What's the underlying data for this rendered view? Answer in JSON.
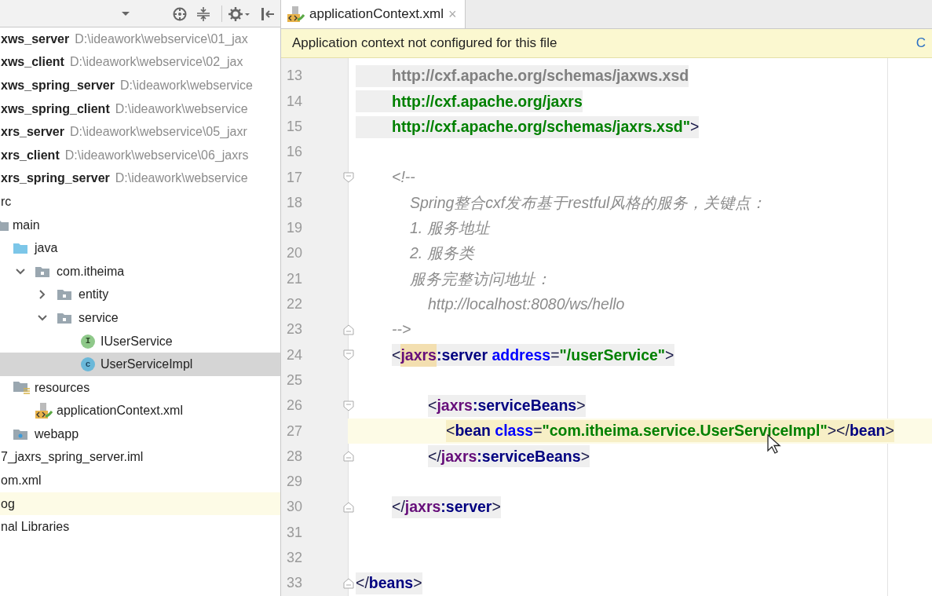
{
  "project_panel": {
    "tree": [
      {
        "name": "xws_server",
        "path": "D:\\ideawork\\webservice\\01_jax"
      },
      {
        "name": "xws_client",
        "path": "D:\\ideawork\\webservice\\02_jax"
      },
      {
        "name": "xws_spring_server",
        "path": "D:\\ideawork\\webservice"
      },
      {
        "name": "xws_spring_client",
        "path": "D:\\ideawork\\webservice"
      },
      {
        "name": "xrs_server",
        "path": "D:\\ideawork\\webservice\\05_jaxr"
      },
      {
        "name": "xrs_client",
        "path": "D:\\ideawork\\webservice\\06_jaxrs"
      },
      {
        "name": "xrs_spring_server",
        "path": "D:\\ideawork\\webservice"
      },
      {
        "name": "rc",
        "children": [
          {
            "kind": "folder",
            "name": "main",
            "children": [
              {
                "kind": "source-folder",
                "name": "java",
                "children": [
                  {
                    "kind": "package",
                    "name": "com.itheima",
                    "expanded": true,
                    "children": [
                      {
                        "kind": "package",
                        "name": "entity",
                        "expanded": false
                      },
                      {
                        "kind": "package",
                        "name": "service",
                        "expanded": true,
                        "children": [
                          {
                            "kind": "interface",
                            "name": "IUserService",
                            "icon_letter": "I",
                            "selected": false
                          },
                          {
                            "kind": "class",
                            "name": "UserServiceImpl",
                            "icon_letter": "c",
                            "selected": true
                          }
                        ]
                      }
                    ]
                  }
                ]
              },
              {
                "kind": "resources",
                "name": "resources",
                "children": [
                  {
                    "kind": "xml",
                    "name": "applicationContext.xml"
                  }
                ]
              },
              {
                "kind": "web-folder",
                "name": "webapp"
              }
            ]
          }
        ]
      },
      {
        "name": "7_jaxrs_spring_server.iml"
      },
      {
        "name": "om.xml"
      },
      {
        "name": "og",
        "highlighted": true
      },
      {
        "name": "nal Libraries",
        "highlighted": false
      }
    ]
  },
  "editor": {
    "tabs": [
      {
        "label": "applicationContext.xml",
        "close": "×",
        "selected": true
      }
    ],
    "banner": {
      "message": "Application context not configured for this file",
      "action": "C"
    },
    "lines": [
      {
        "number": "13",
        "kind": "continuation",
        "highlighted": true,
        "tokens": [
          {
            "kind": "grey",
            "t": "http://cxf.apache.org/schemas/jaxws.xsd"
          }
        ]
      },
      {
        "number": "14",
        "kind": "continuation",
        "highlighted": true,
        "tokens": [
          {
            "kind": "value",
            "t": "http://cxf.apache.org/jaxrs"
          }
        ]
      },
      {
        "number": "15",
        "kind": "continuation",
        "highlighted": true,
        "tokens": [
          {
            "kind": "value",
            "t": "http://cxf.apache.org/schemas/jaxrs.xsd\""
          },
          {
            "kind": "punct",
            "t": ">"
          }
        ]
      },
      {
        "number": "16"
      },
      {
        "number": "17",
        "fold_start": true,
        "kind": "inner",
        "tokens": [
          {
            "kind": "comment",
            "t": "<!--"
          }
        ]
      },
      {
        "number": "18",
        "kind": "text",
        "tokens": [
          {
            "kind": "comment",
            "t": "Spring整合cxf发布基于restful风格的服务，关键点："
          }
        ]
      },
      {
        "number": "19",
        "kind": "text",
        "tokens": [
          {
            "kind": "comment",
            "t": "1. 服务地址"
          }
        ]
      },
      {
        "number": "20",
        "kind": "text",
        "tokens": [
          {
            "kind": "comment",
            "t": "2. 服务类"
          }
        ]
      },
      {
        "number": "21",
        "kind": "text",
        "tokens": [
          {
            "kind": "comment",
            "t": "服务完整访问地址："
          }
        ]
      },
      {
        "number": "22",
        "kind": "deep",
        "tokens": [
          {
            "kind": "comment",
            "t": "http://localhost:8080/ws/hello"
          }
        ]
      },
      {
        "number": "23",
        "fold_end": true,
        "kind": "inner",
        "tokens": [
          {
            "kind": "comment",
            "t": "-->"
          }
        ]
      },
      {
        "number": "24",
        "fold_start": true,
        "highlighted": true,
        "kind": "inner",
        "tokens": [
          {
            "kind": "punct",
            "t": "<"
          },
          {
            "kind": "ns",
            "t": "jaxrs",
            "matched": true
          },
          {
            "kind": "tag",
            "t": ":server"
          },
          {
            "kind": "attr",
            "t": " address"
          },
          {
            "kind": "punct",
            "t": "="
          },
          {
            "kind": "value",
            "t": "\"/userService\""
          },
          {
            "kind": "punct",
            "t": ">"
          }
        ]
      },
      {
        "number": "25"
      },
      {
        "number": "26",
        "fold_start": true,
        "highlighted": true,
        "kind": "deep",
        "tokens": [
          {
            "kind": "punct",
            "t": "<"
          },
          {
            "kind": "ns",
            "t": "jaxrs",
            "matched": false
          },
          {
            "kind": "tag",
            "t": ":serviceBeans"
          },
          {
            "kind": "punct",
            "t": ">"
          }
        ]
      },
      {
        "number": "27",
        "current": true,
        "highlighted": true,
        "kind": "deeper",
        "tokens": [
          {
            "kind": "punct",
            "t": "<"
          },
          {
            "kind": "tag",
            "t": "bean"
          },
          {
            "kind": "attr",
            "t": " class"
          },
          {
            "kind": "punct",
            "t": "="
          },
          {
            "kind": "value",
            "t": "\"com.itheima.service.UserServiceImpl\""
          },
          {
            "kind": "punct",
            "t": "></"
          },
          {
            "kind": "tag",
            "t": "bean"
          },
          {
            "kind": "punct",
            "t": ">"
          }
        ]
      },
      {
        "number": "28",
        "fold_end": true,
        "highlighted": true,
        "kind": "deep",
        "tokens": [
          {
            "kind": "punct",
            "t": "</"
          },
          {
            "kind": "ns",
            "t": "jaxrs"
          },
          {
            "kind": "tag",
            "t": ":serviceBeans"
          },
          {
            "kind": "punct",
            "t": ">"
          }
        ]
      },
      {
        "number": "29"
      },
      {
        "number": "30",
        "fold_end": true,
        "highlighted": true,
        "kind": "inner",
        "tokens": [
          {
            "kind": "punct",
            "t": "</"
          },
          {
            "kind": "ns",
            "t": "jaxrs"
          },
          {
            "kind": "tag",
            "t": ":server"
          },
          {
            "kind": "punct",
            "t": ">"
          }
        ]
      },
      {
        "number": "31"
      },
      {
        "number": "32"
      },
      {
        "number": "33",
        "fold_end": true,
        "highlighted": true,
        "kind": "flat",
        "tokens": [
          {
            "kind": "punct",
            "t": "</"
          },
          {
            "kind": "tag",
            "t": "beans"
          },
          {
            "kind": "punct",
            "t": ">"
          }
        ]
      }
    ]
  }
}
